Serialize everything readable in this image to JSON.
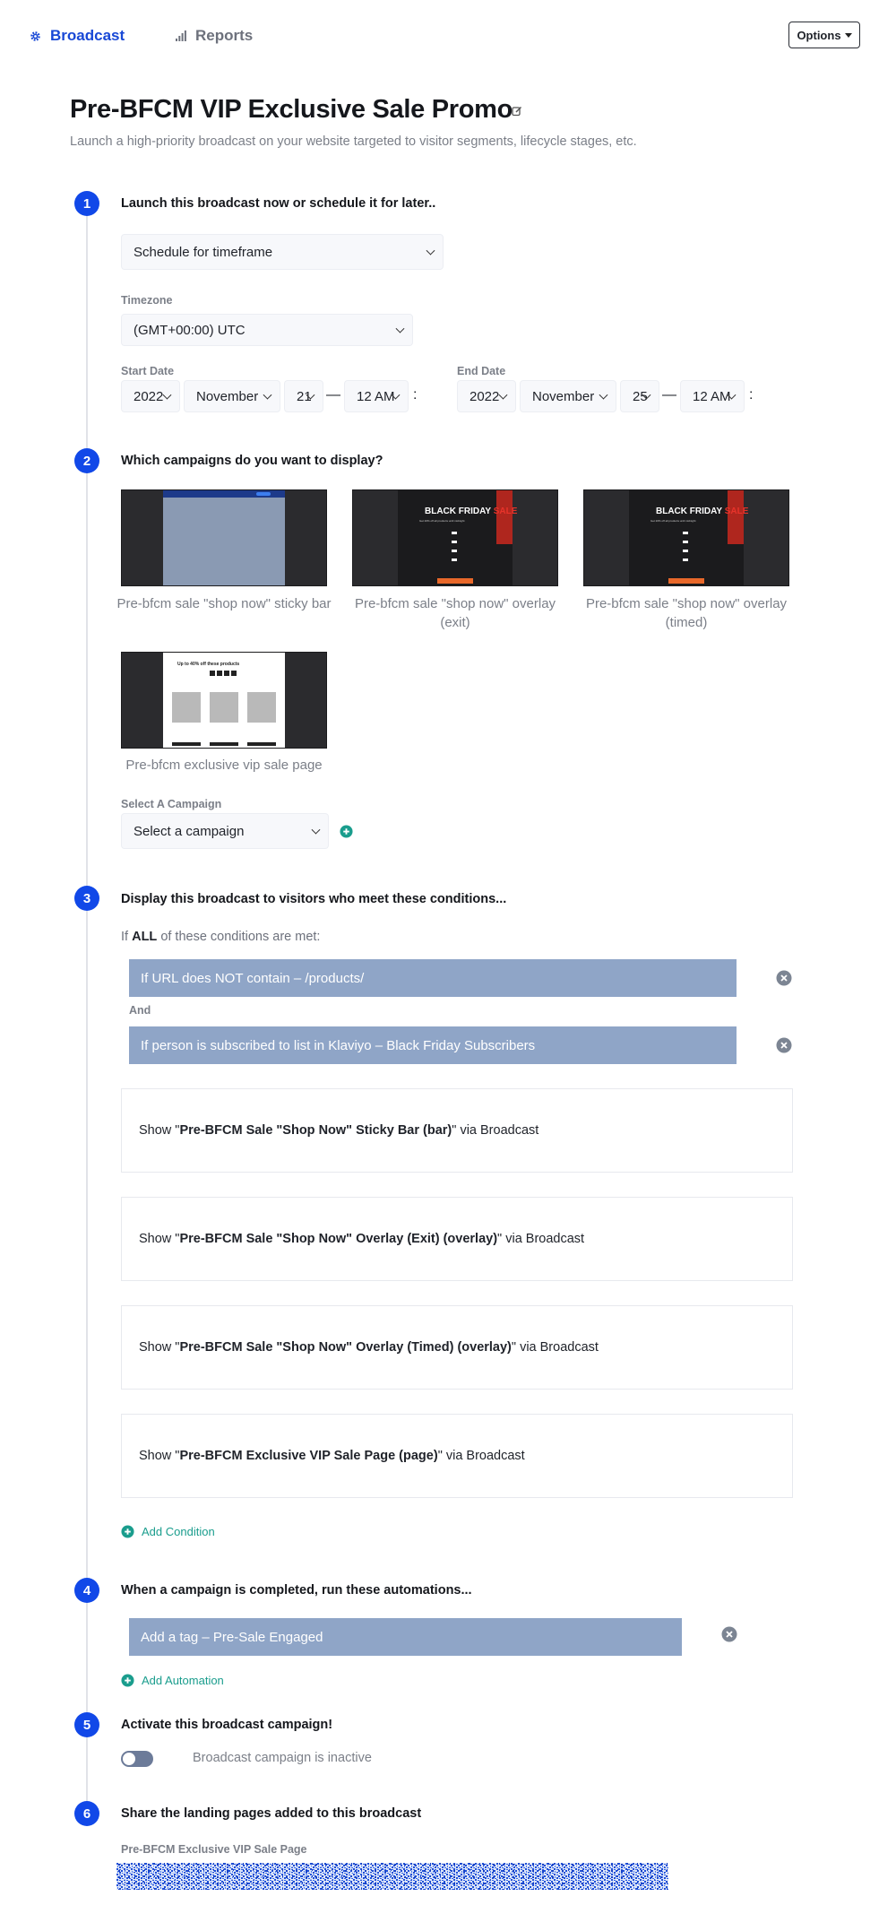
{
  "nav": {
    "broadcast_label": "Broadcast",
    "reports_label": "Reports",
    "options_label": "Options"
  },
  "page": {
    "title": "Pre-BFCM VIP Exclusive Sale Promo",
    "subtitle": "Launch a high-priority broadcast on your website targeted to visitor segments, lifecycle stages, etc."
  },
  "steps": [
    {
      "number": "1",
      "title": "Launch this broadcast now or schedule it for later.."
    },
    {
      "number": "2",
      "title": "Which campaigns do you want to display?"
    },
    {
      "number": "3",
      "title": "Display this broadcast to visitors who meet these conditions..."
    },
    {
      "number": "4",
      "title": "When a campaign is completed, run these automations..."
    },
    {
      "number": "5",
      "title": "Activate this broadcast campaign!"
    },
    {
      "number": "6",
      "title": "Share the landing pages added to this broadcast"
    }
  ],
  "schedule": {
    "mode": "Schedule for timeframe",
    "timezone_label": "Timezone",
    "timezone": "(GMT+00:00) UTC",
    "start_label": "Start Date",
    "start": {
      "year": "2022",
      "month": "November",
      "day": "21",
      "time": "12 AM"
    },
    "end_label": "End Date",
    "end": {
      "year": "2022",
      "month": "November",
      "day": "25",
      "time": "12 AM"
    },
    "dash": "—",
    "colon": ":"
  },
  "campaigns": [
    {
      "caption": "Pre-bfcm sale \"shop now\" sticky bar"
    },
    {
      "caption": "Pre-bfcm sale \"shop now\" overlay (exit)"
    },
    {
      "caption": "Pre-bfcm sale \"shop now\" overlay (timed)"
    },
    {
      "caption": "Pre-bfcm exclusive vip sale page"
    }
  ],
  "thumb_text": {
    "black": "BLACK FRIDAY",
    "sale": "SALE",
    "tagline": "Get 20% off all products until midnight",
    "vip_heading": "Up to 40% off these products"
  },
  "select_campaign": {
    "label": "Select A Campaign",
    "value": "Select a campaign"
  },
  "conditions": {
    "intro_prefix": "If",
    "intro_bold": "ALL",
    "intro_suffix": "of these conditions are met:",
    "items": [
      "If URL does NOT contain – /products/",
      "If person is subscribed to list in Klaviyo – Black Friday Subscribers"
    ],
    "joiner": "And",
    "shows": [
      {
        "prefix": "Show \"",
        "bold": "Pre-BFCM Sale \"Shop Now\" Sticky Bar (bar)",
        "suffix": "\" via Broadcast"
      },
      {
        "prefix": "Show \"",
        "bold": "Pre-BFCM Sale \"Shop Now\" Overlay (Exit) (overlay)",
        "suffix": "\" via Broadcast"
      },
      {
        "prefix": "Show \"",
        "bold": "Pre-BFCM Sale \"Shop Now\" Overlay (Timed) (overlay)",
        "suffix": "\" via Broadcast"
      },
      {
        "prefix": "Show \"",
        "bold": "Pre-BFCM Exclusive VIP Sale Page (page)",
        "suffix": "\" via Broadcast"
      }
    ],
    "add_label": "Add Condition"
  },
  "automations": {
    "items": [
      "Add a tag – Pre-Sale Engaged"
    ],
    "add_label": "Add Automation"
  },
  "activate": {
    "toggle_on": false,
    "status": "Broadcast campaign is inactive"
  },
  "share": {
    "page_label": "Pre-BFCM Exclusive VIP Sale Page"
  },
  "colors": {
    "accent": "#1148e8",
    "condition_bar": "#8fa5c7",
    "add_link": "#1a9d8d",
    "sale_red": "#e8332a"
  }
}
